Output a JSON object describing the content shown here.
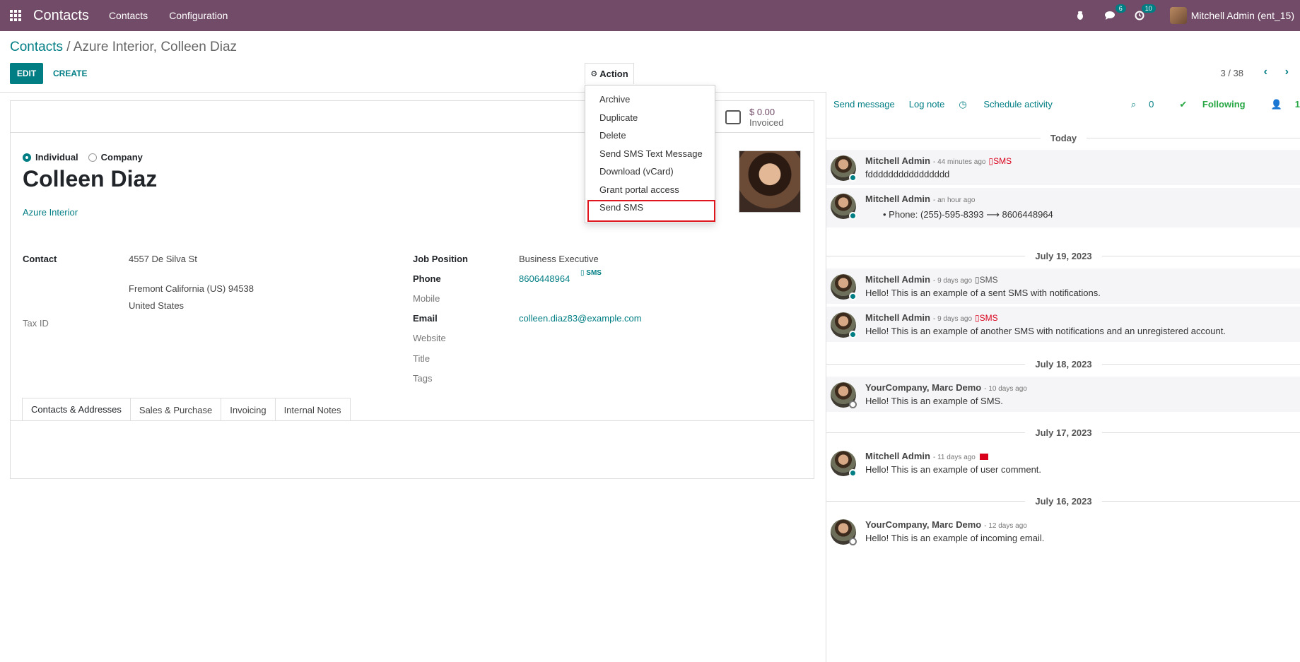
{
  "navbar": {
    "brand": "Contacts",
    "menu": [
      "Contacts",
      "Configuration"
    ],
    "chat_badge": "6",
    "activity_badge": "10",
    "user": "Mitchell Admin (ent_15)"
  },
  "breadcrumb": {
    "root": "Contacts",
    "separator": " / ",
    "current": "Azure Interior, Colleen Diaz"
  },
  "buttons": {
    "edit": "EDIT",
    "create": "CREATE",
    "action": "Action"
  },
  "pager": {
    "value": "3 / 38"
  },
  "action_menu": {
    "items": [
      "Archive",
      "Duplicate",
      "Delete",
      "Send SMS Text Message",
      "Download (vCard)",
      "Grant portal access",
      "Send SMS"
    ]
  },
  "stat": {
    "value": "$ 0.00",
    "label": "Invoiced"
  },
  "form": {
    "type_individual": "Individual",
    "type_company": "Company",
    "name": "Colleen Diaz",
    "company": "Azure Interior",
    "labels": {
      "contact": "Contact",
      "tax_id": "Tax ID",
      "job_position": "Job Position",
      "phone": "Phone",
      "mobile": "Mobile",
      "email": "Email",
      "website": "Website",
      "title": "Title",
      "tags": "Tags"
    },
    "address": {
      "street": "4557 De Silva St",
      "city_line": "Fremont  California (US)  94538",
      "country": "United States"
    },
    "job_position": "Business Executive",
    "phone": "8606448964",
    "sms": "SMS",
    "email": "colleen.diaz83@example.com"
  },
  "tabs": [
    "Contacts & Addresses",
    "Sales & Purchase",
    "Invoicing",
    "Internal Notes"
  ],
  "chatter": {
    "send_message": "Send message",
    "log_note": "Log note",
    "schedule_activity": "Schedule activity",
    "attachments": "0",
    "following": "Following",
    "followers": "1",
    "dates": [
      "Today",
      "July 19, 2023",
      "July 18, 2023",
      "July 17, 2023",
      "July 16, 2023"
    ],
    "messages": [
      {
        "author": "Mitchell Admin",
        "date": "- 44 minutes ago",
        "type": "SMS",
        "body": "fdddddddddddddddd"
      },
      {
        "author": "Mitchell Admin",
        "date": "- an hour ago",
        "type": "",
        "body": "Phone: (255)-595-8393 ⟶ 8606448964"
      },
      {
        "author": "Mitchell Admin",
        "date": "- 9 days ago",
        "type": "SMS",
        "body": "Hello! This is an example of a sent SMS with notifications."
      },
      {
        "author": "Mitchell Admin",
        "date": "- 9 days ago",
        "type": "SMS",
        "body": "Hello! This is an example of another SMS with notifications and an unregistered account."
      },
      {
        "author": "YourCompany, Marc Demo",
        "date": "- 10 days ago",
        "type": "",
        "body": "Hello! This is an example of SMS."
      },
      {
        "author": "Mitchell Admin",
        "date": "- 11 days ago",
        "type": "",
        "body": "Hello! This is an example of user comment."
      },
      {
        "author": "YourCompany, Marc Demo",
        "date": "- 12 days ago",
        "type": "",
        "body": "Hello! This is an example of incoming email."
      }
    ]
  },
  "colors": {
    "brand": "#714b67",
    "accent": "#017e84",
    "highlight": "#e0161f"
  }
}
